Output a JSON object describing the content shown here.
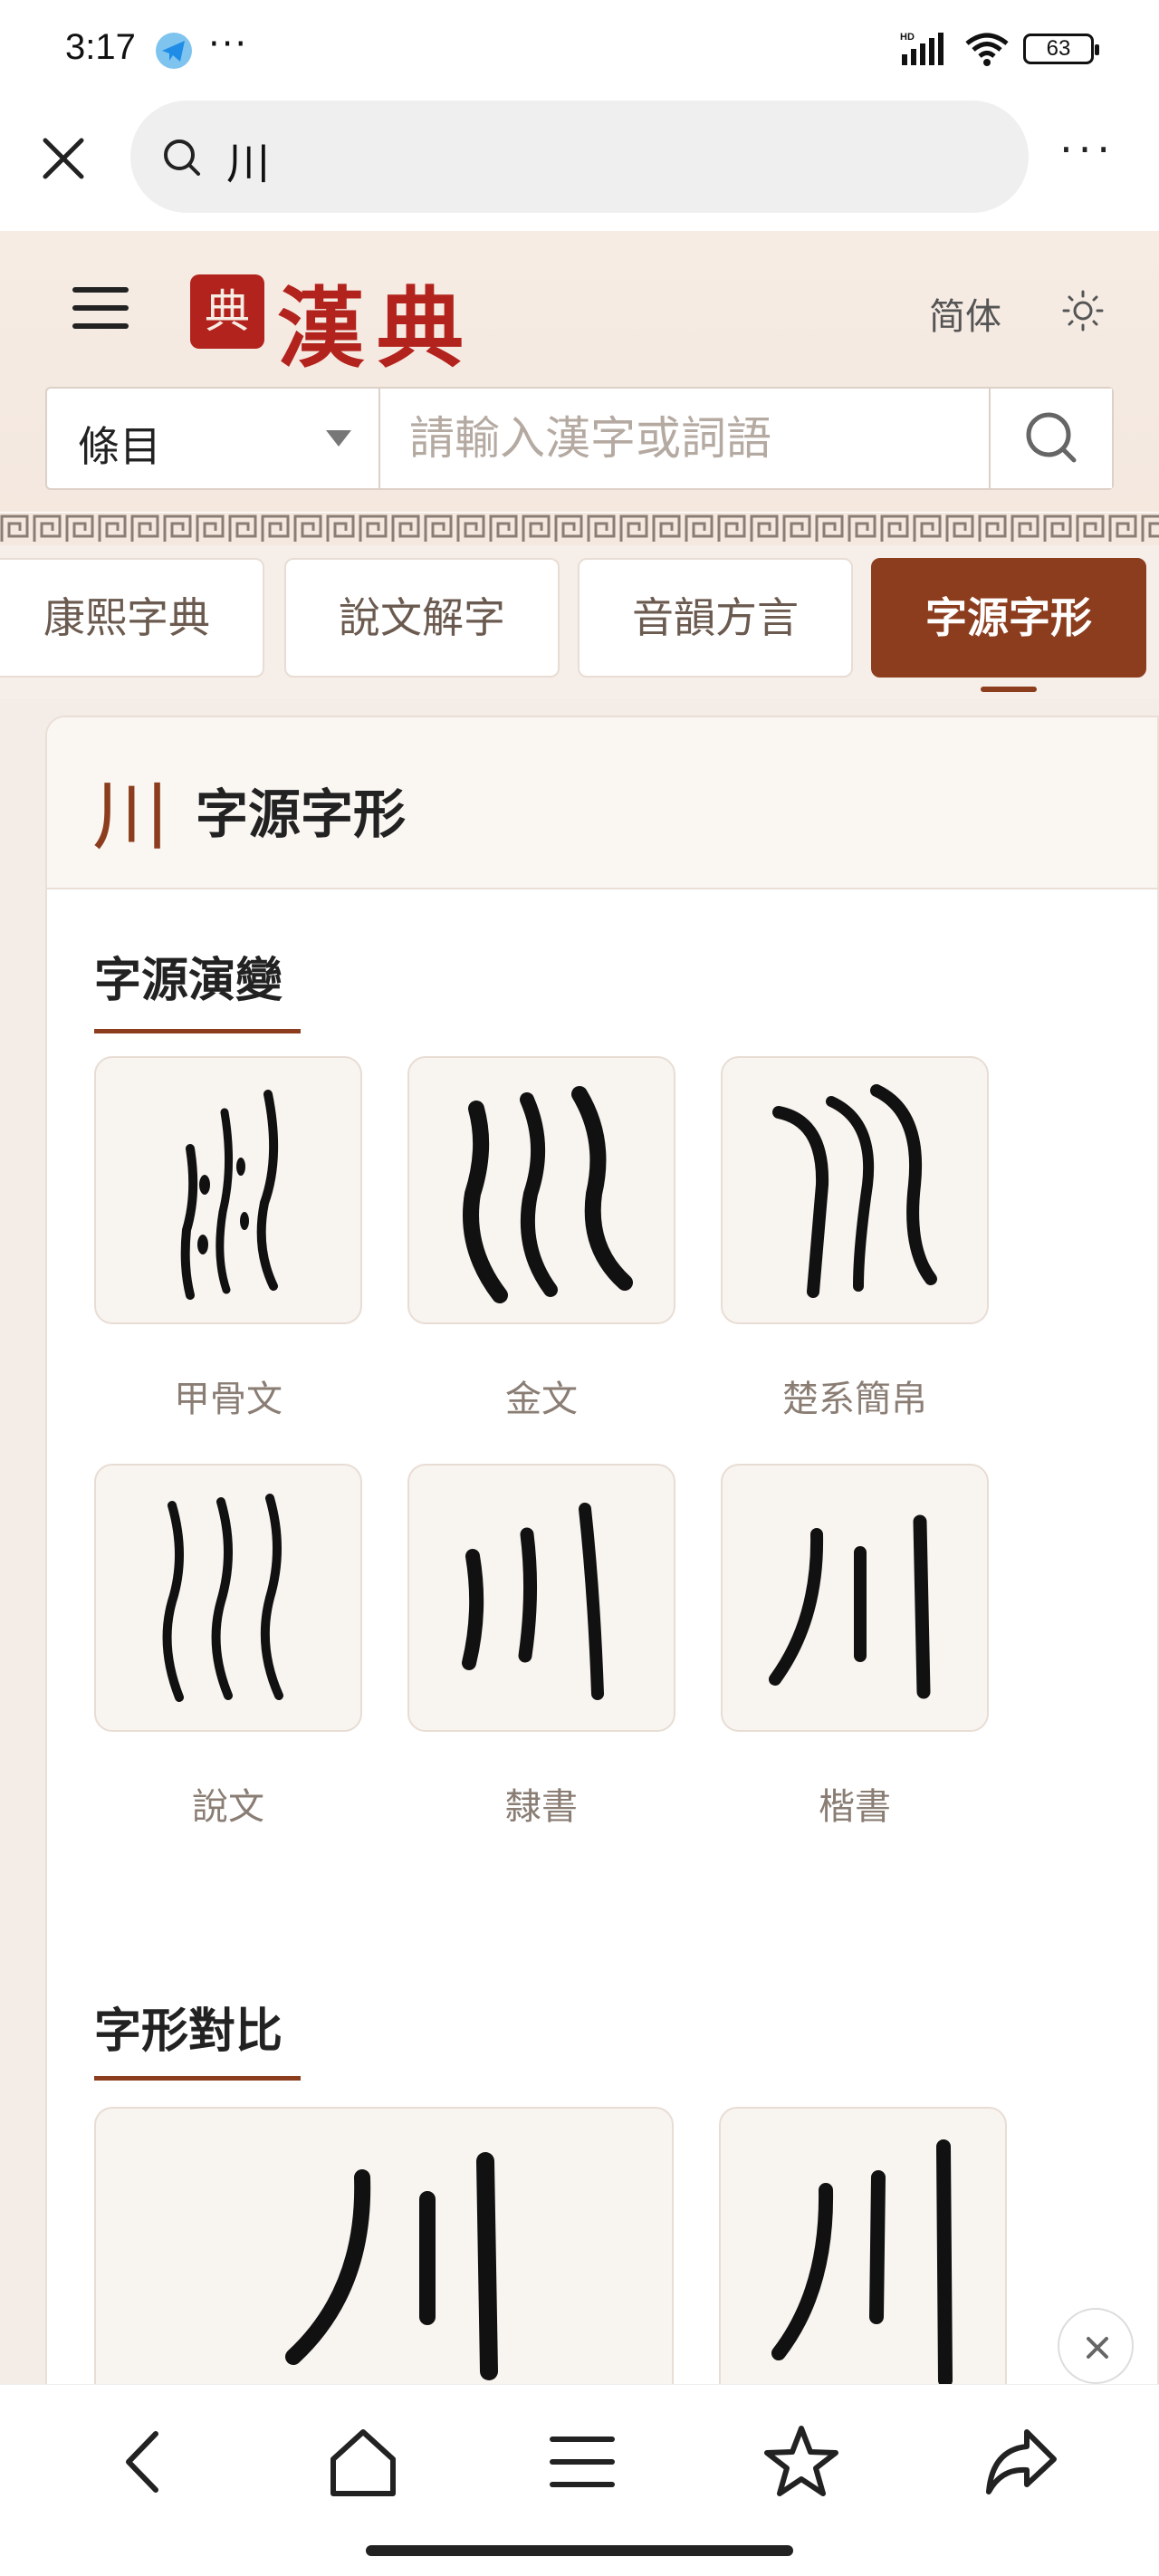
{
  "status_bar": {
    "time": "3:17",
    "dots": "···",
    "network": "HD",
    "battery": "63"
  },
  "browser": {
    "url_query": "川",
    "more": "···"
  },
  "site": {
    "seal": "典",
    "brand": "漢典",
    "lang_toggle": "简体",
    "search_scope": "條目",
    "search_placeholder": "請輸入漢字或詞語"
  },
  "tabs": [
    {
      "label": "康熙字典",
      "active": false
    },
    {
      "label": "說文解字",
      "active": false
    },
    {
      "label": "音韻方言",
      "active": false
    },
    {
      "label": "字源字形",
      "active": true
    }
  ],
  "panel": {
    "char": "川",
    "title": "字源字形"
  },
  "evolution": {
    "title": "字源演變",
    "items": [
      {
        "label": "甲骨文"
      },
      {
        "label": "金文"
      },
      {
        "label": "楚系簡帛"
      },
      {
        "label": "說文"
      },
      {
        "label": "隸書"
      },
      {
        "label": "楷書"
      }
    ]
  },
  "comparison": {
    "title": "字形對比",
    "glyph": "川"
  },
  "colors": {
    "accent": "#8c3d1e",
    "brand_red": "#b3231d",
    "header_bg": "#f4e8df"
  }
}
